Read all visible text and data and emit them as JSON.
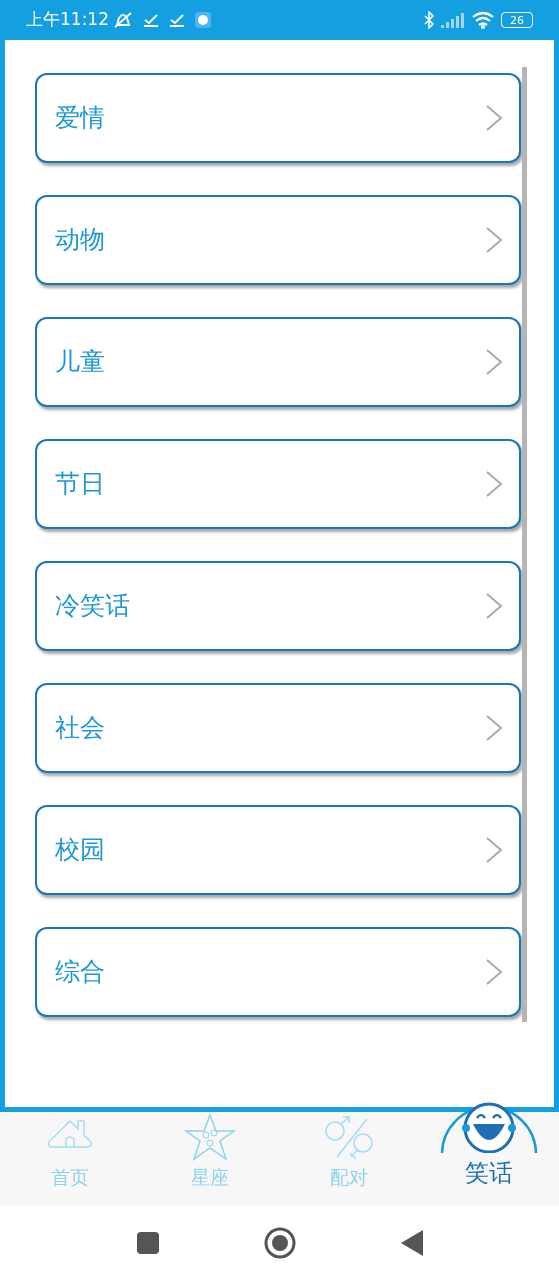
{
  "status_bar": {
    "time": "上午11:12",
    "battery": "26"
  },
  "categories": [
    {
      "label": "爱情"
    },
    {
      "label": "动物"
    },
    {
      "label": "儿童"
    },
    {
      "label": "节日"
    },
    {
      "label": "冷笑话"
    },
    {
      "label": "社会"
    },
    {
      "label": "校园"
    },
    {
      "label": "综合"
    }
  ],
  "tabs": [
    {
      "label": "首页",
      "kind": "home",
      "selected": false
    },
    {
      "label": "星座",
      "kind": "star",
      "selected": false
    },
    {
      "label": "配对",
      "kind": "pair",
      "selected": false
    },
    {
      "label": "笑话",
      "kind": "joke",
      "selected": true
    }
  ]
}
